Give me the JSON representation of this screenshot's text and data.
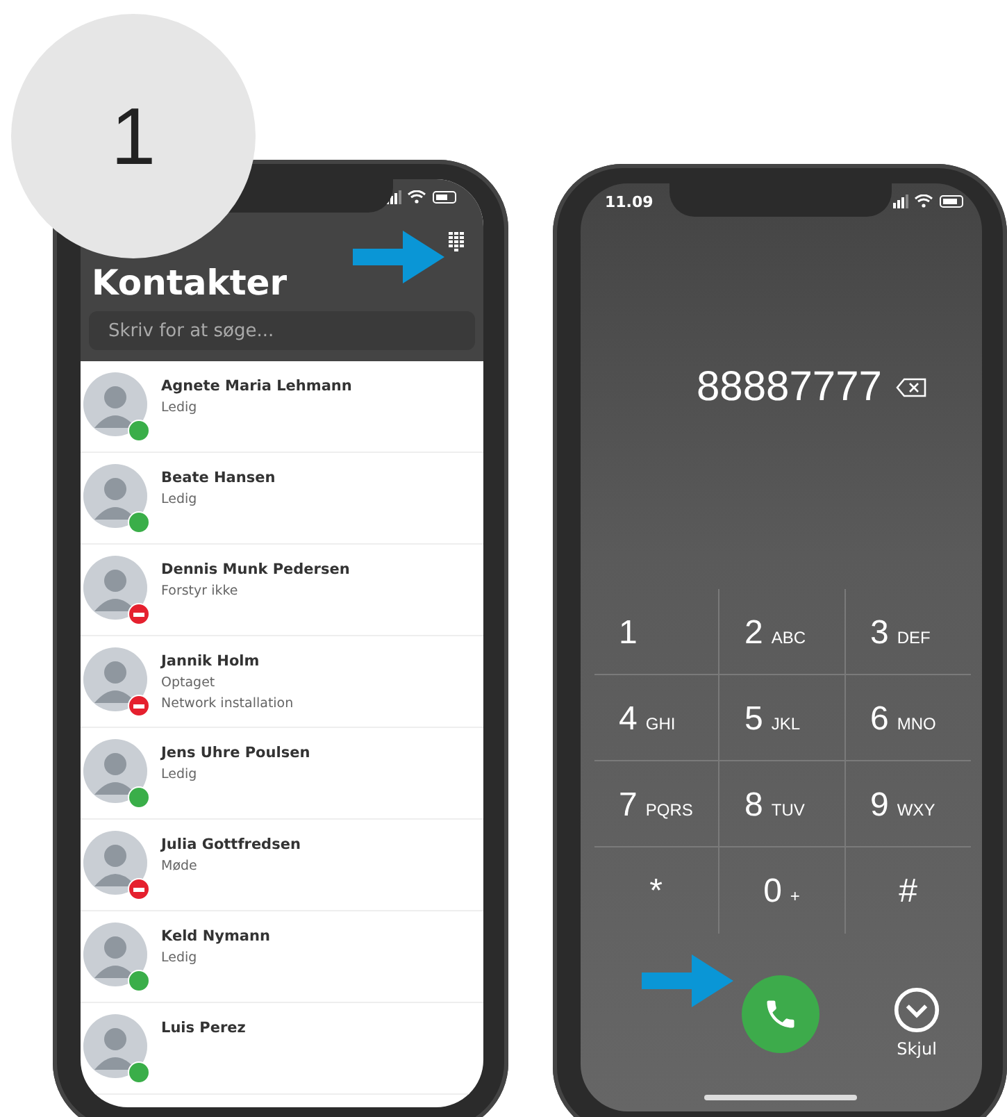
{
  "step_badge": {
    "label": "1"
  },
  "contacts_screen": {
    "title": "Kontakter",
    "search": {
      "placeholder": "Skriv for at søge..."
    },
    "contacts": [
      {
        "name": "Agnete Maria Lehmann",
        "status": "Ledig",
        "kind": "available"
      },
      {
        "name": "Beate Hansen",
        "status": "Ledig",
        "kind": "available"
      },
      {
        "name": "Dennis Munk Pedersen",
        "status": "Forstyr ikke",
        "kind": "busy"
      },
      {
        "name": "Jannik Holm",
        "status": "Optaget",
        "note": "Network installation",
        "kind": "busy"
      },
      {
        "name": "Jens Uhre Poulsen",
        "status": "Ledig",
        "kind": "available"
      },
      {
        "name": "Julia Gottfredsen",
        "status": "Møde",
        "kind": "busy"
      },
      {
        "name": "Keld Nymann",
        "status": "Ledig",
        "kind": "available"
      },
      {
        "name": "Luis Perez",
        "kind": "available"
      }
    ]
  },
  "dialer_screen": {
    "time": "11.09",
    "number": "88887777",
    "keys": [
      {
        "digit": "1"
      },
      {
        "digit": "2",
        "letters": "ABC"
      },
      {
        "digit": "3",
        "letters": "DEF"
      },
      {
        "digit": "4",
        "letters": "GHI"
      },
      {
        "digit": "5",
        "letters": "JKL"
      },
      {
        "digit": "6",
        "letters": "MNO"
      },
      {
        "digit": "7",
        "letters": "PQRS"
      },
      {
        "digit": "8",
        "letters": "TUV"
      },
      {
        "digit": "9",
        "letters": "WXY"
      },
      {
        "digit": "*"
      },
      {
        "digit": "0",
        "letters": "+"
      },
      {
        "digit": "#"
      }
    ],
    "hide_label": "Skjul"
  }
}
